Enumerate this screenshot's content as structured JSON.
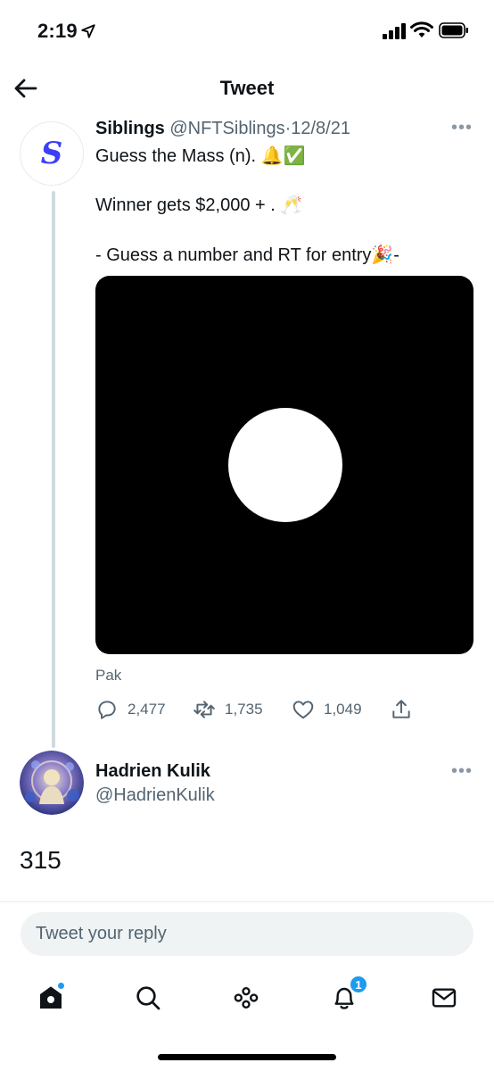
{
  "status_bar": {
    "time": "2:19"
  },
  "header": {
    "title": "Tweet"
  },
  "tweet": {
    "author_name": "Siblings",
    "handle": "@NFTSiblings",
    "separator": "·",
    "date": "12/8/21",
    "avatar_letter": "S",
    "lines": [
      "Guess the Mass (n). 🔔✅",
      "Winner gets $2,000 + . 🥂",
      "- Guess a number and RT for entry🎉-"
    ],
    "media_caption": "Pak",
    "stats": {
      "replies": "2,477",
      "retweets": "1,735",
      "likes": "1,049"
    }
  },
  "reply": {
    "author_name": "Hadrien Kulik",
    "handle": "@HadrienKulik",
    "text": "315"
  },
  "composer": {
    "placeholder": "Tweet your reply"
  },
  "tabbar": {
    "notifications_badge": "1"
  },
  "colors": {
    "accent": "#1d9bf0",
    "text": "#0f1419",
    "muted": "#536471",
    "brand_siblings": "#3b3ff6"
  }
}
